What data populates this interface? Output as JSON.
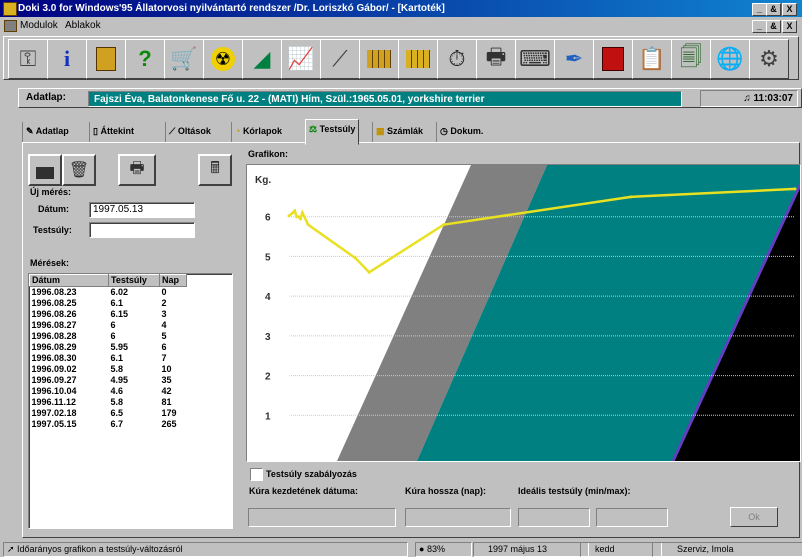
{
  "window": {
    "title": "Doki 3.0 for Windows'95 Állatorvosi nyilvántartó rendszer /Dr. Loriszkó Gábor/ - [Kartoték]",
    "ctrl_min": "_",
    "ctrl_max": "&",
    "ctrl_close": "X"
  },
  "menu": {
    "modulok": "Modulok",
    "ablakok": "Ablakok"
  },
  "toolbar": {
    "icons": [
      "key-icon",
      "info-icon",
      "calculator-icon",
      "help-icon",
      "cart-icon",
      "radiation-icon",
      "scalpel-icon",
      "chart-icon",
      "syringe-icon",
      "calendar-icon",
      "calendar-grid-icon",
      "stopwatch-icon",
      "printer-icon",
      "typewriter-icon",
      "dropper-icon",
      "book-icon",
      "notes-icon",
      "documents-icon",
      "globe-icon",
      "settings-icon"
    ]
  },
  "patient_bar": {
    "label": "Adatlap:",
    "value": "Fajszi Éva, Balatonkenese Fő u. 22 - (MATI) Hím, Szül.:1965.05.01, yorkshire terrier",
    "clock": "11:03:07"
  },
  "tabs": [
    {
      "label": "Adatlap",
      "icon": "pencil-icon"
    },
    {
      "label": "Áttekint",
      "icon": "list-icon"
    },
    {
      "label": "Oltások",
      "icon": "syringe-icon"
    },
    {
      "label": "Kórlapok",
      "icon": "folder-icon"
    },
    {
      "label": "Testsúly",
      "icon": "scale-icon",
      "active": true
    },
    {
      "label": "Számlák",
      "icon": "invoice-icon"
    },
    {
      "label": "Dokum.",
      "icon": "clock-icon"
    }
  ],
  "left": {
    "new_measure_label": "Új mérés:",
    "date_label": "Dátum:",
    "date_value": "1997.05.13",
    "weight_label": "Testsúly:",
    "weight_value": "",
    "measures_label": "Mérések:",
    "table_headers": [
      "Dátum",
      "Testsúly",
      "Nap"
    ],
    "rows": [
      [
        "1996.08.23",
        "6.02",
        "0"
      ],
      [
        "1996.08.25",
        "6.1",
        "2"
      ],
      [
        "1996.08.26",
        "6.15",
        "3"
      ],
      [
        "1996.08.27",
        "6",
        "4"
      ],
      [
        "1996.08.28",
        "6",
        "5"
      ],
      [
        "1996.08.29",
        "5.95",
        "6"
      ],
      [
        "1996.08.30",
        "6.1",
        "7"
      ],
      [
        "1996.09.02",
        "5.8",
        "10"
      ],
      [
        "1996.09.27",
        "4.95",
        "35"
      ],
      [
        "1996.10.04",
        "4.6",
        "42"
      ],
      [
        "1996.11.12",
        "5.8",
        "81"
      ],
      [
        "1997.02.18",
        "6.5",
        "179"
      ],
      [
        "1997.05.15",
        "6.7",
        "265"
      ]
    ]
  },
  "graph": {
    "label": "Grafikon:",
    "ylabel": "Kg.",
    "yticks": [
      "1",
      "2",
      "3",
      "4",
      "5",
      "6"
    ]
  },
  "chart_data": {
    "type": "line",
    "ylabel": "Kg.",
    "ylim": [
      0,
      7
    ],
    "xlim": [
      0,
      265
    ],
    "grid": true,
    "series": [
      {
        "x": [
          0,
          2,
          3,
          4,
          5,
          6,
          7,
          10,
          35,
          42,
          81,
          179,
          265
        ],
        "values": [
          6.02,
          6.1,
          6.15,
          6.0,
          6.0,
          5.95,
          6.1,
          5.8,
          4.95,
          4.6,
          5.8,
          6.5,
          6.7
        ],
        "color": "#e8e020"
      }
    ],
    "bands": [
      "#ffffff",
      "#808080",
      "#008080",
      "#000000"
    ]
  },
  "bottom": {
    "checkbox_label": "Testsúly szabályozás",
    "start_label": "Kúra kezdetének dátuma:",
    "length_label": "Kúra hossza (nap):",
    "ideal_label": "Ideális testsúly (min/max):",
    "ok_label": "Ok"
  },
  "status": {
    "hint": "Időarányos grafikon a testsúly-változásról",
    "zoom": "83%",
    "date": "1997 május 13",
    "day": "kedd",
    "user": "Szerviz, Imola"
  }
}
